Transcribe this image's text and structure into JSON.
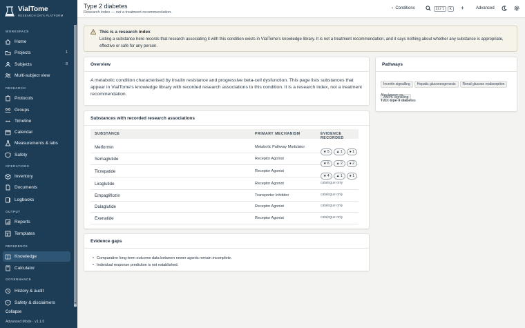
{
  "brand": {
    "name": "VialTome",
    "subtitle": "RESEARCH DATA PLATFORM"
  },
  "sidebar": {
    "sections": [
      {
        "label": "WORKSPACE",
        "items": [
          {
            "label": "Home",
            "icon": "home-icon"
          },
          {
            "label": "Projects",
            "count": "1",
            "icon": "folder-icon"
          },
          {
            "label": "Subjects",
            "count": "8",
            "icon": "person-icon"
          },
          {
            "label": "Multi-subject view",
            "icon": "group-icon"
          }
        ]
      },
      {
        "label": "RESEARCH",
        "items": [
          {
            "label": "Protocols",
            "icon": "clipboard-icon"
          },
          {
            "label": "Groups",
            "icon": "groups-icon"
          },
          {
            "label": "Timeline",
            "icon": "timeline-icon"
          },
          {
            "label": "Calendar",
            "icon": "calendar-icon"
          },
          {
            "label": "Measurements & labs",
            "icon": "flask-icon"
          },
          {
            "label": "Safety",
            "icon": "shield-icon"
          }
        ]
      },
      {
        "label": "OPERATIONS",
        "items": [
          {
            "label": "Inventory",
            "icon": "box-icon"
          },
          {
            "label": "Documents",
            "icon": "document-icon"
          },
          {
            "label": "Logbooks",
            "icon": "book-icon"
          }
        ]
      },
      {
        "label": "OUTPUT",
        "items": [
          {
            "label": "Reports",
            "icon": "report-icon"
          },
          {
            "label": "Templates",
            "icon": "template-icon"
          }
        ]
      },
      {
        "label": "REFERENCE",
        "items": [
          {
            "label": "Knowledge",
            "icon": "knowledge-icon",
            "active": true
          },
          {
            "label": "Calculator",
            "icon": "calculator-icon"
          }
        ]
      },
      {
        "label": "GOVERNANCE",
        "items": [
          {
            "label": "History & audit",
            "icon": "history-icon"
          },
          {
            "label": "Safety & disclaimers",
            "icon": "disclaimer-icon"
          }
        ]
      }
    ],
    "collapse_label": "Collapse",
    "mode_label": "Advanced Mode · v1.1.0"
  },
  "header": {
    "title": "Type 2 diabetes",
    "subtitle_prefix": "Research index — ",
    "subtitle_em": "not",
    "subtitle_suffix": " a treatment recommendation.",
    "conditions_label": "Conditions",
    "kbd_ctrl": "Ctrl",
    "kbd_k": "K",
    "advanced_label": "Advanced"
  },
  "warning": {
    "title": "This is a research index",
    "body": "Listing a substance here records that research associating it with this condition exists in VialTome's knowledge library. It is not a treatment recommendation, and it says nothing about whether any substance is appropriate, effective or safe for any person."
  },
  "overview": {
    "title": "Overview",
    "text": "A metabolic condition characterised by insulin resistance and progressive beta-cell dysfunction. This page lists substances that appear in VialTome's knowledge library with recorded research associations to this condition. It is a research index, not a treatment recommendation."
  },
  "pathways": {
    "title": "Pathways",
    "tags": [
      "Incretin signalling",
      "Hepatic gluconeogenesis",
      "Renal glucose reabsorption",
      "AMPK signalling"
    ],
    "aka_label": "Also known as",
    "aka_value": "T2D; type II diabetes"
  },
  "substances": {
    "title": "Substances with recorded research associations",
    "headers": [
      "SUBSTANCE",
      "PRIMARY MECHANISM",
      "EVIDENCE RECORDED"
    ],
    "rows": [
      {
        "name": "Metformin",
        "mechanism": "Metabolic Pathway Modulator",
        "evidence": [
          "★ 5",
          "▲ 1",
          "● 1"
        ]
      },
      {
        "name": "Semaglutide",
        "mechanism": "Receptor Agonist",
        "evidence": [
          "★ 6",
          "▲ 2",
          "● 2"
        ]
      },
      {
        "name": "Tirzepatide",
        "mechanism": "Receptor Agonist",
        "evidence": [
          "★ 4",
          "▲ 1",
          "● 1"
        ]
      },
      {
        "name": "Liraglutide",
        "mechanism": "Receptor Agonist",
        "catalogue": "catalogue only"
      },
      {
        "name": "Empagliflozin",
        "mechanism": "Transporter Inhibitor",
        "catalogue": "catalogue only"
      },
      {
        "name": "Dulaglutide",
        "mechanism": "Receptor Agonist",
        "catalogue": "catalogue only"
      },
      {
        "name": "Exenatide",
        "mechanism": "Receptor Agonist",
        "catalogue": "catalogue only"
      }
    ]
  },
  "gaps": {
    "title": "Evidence gaps",
    "items": [
      "Comparative long-term outcome data between newer agents remain incomplete.",
      "Individual response prediction is not established."
    ]
  }
}
